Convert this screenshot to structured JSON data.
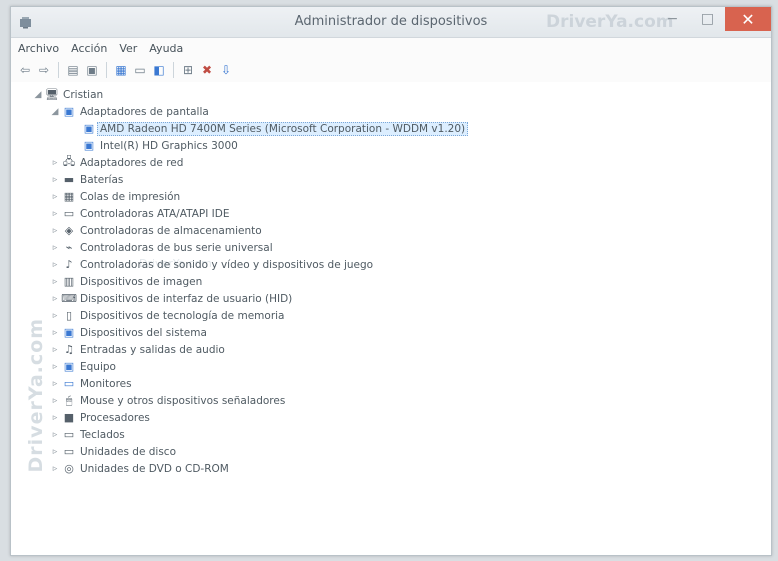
{
  "window": {
    "title": "Administrador de dispositivos",
    "watermark_title": "DriverYa.com",
    "side_watermark": "DriverYa.com",
    "row_watermark": "DriverYa.com"
  },
  "menu": {
    "items": [
      "Archivo",
      "Acción",
      "Ver",
      "Ayuda"
    ]
  },
  "toolbar": {
    "icons": [
      "back-icon",
      "forward-icon",
      "properties-icon",
      "help-icon",
      "device-manager-icon",
      "monitor-icon",
      "scan-icon",
      "update-driver-icon",
      "uninstall-icon",
      "disable-icon"
    ]
  },
  "tree": {
    "root": "Cristian",
    "expanded_category": "Adaptadores de pantalla",
    "display_children": [
      "AMD Radeon HD 7400M Series (Microsoft Corporation - WDDM v1.20)",
      "Intel(R) HD Graphics 3000"
    ],
    "categories": [
      "Adaptadores de red",
      "Baterías",
      "Colas de impresión",
      "Controladoras ATA/ATAPI IDE",
      "Controladoras de almacenamiento",
      "Controladoras de bus serie universal",
      "Controladoras de sonido y vídeo y dispositivos de juego",
      "Dispositivos de imagen",
      "Dispositivos de interfaz de usuario (HID)",
      "Dispositivos de tecnología de memoria",
      "Dispositivos del sistema",
      "Entradas y salidas de audio",
      "Equipo",
      "Monitores",
      "Mouse y otros dispositivos señaladores",
      "Procesadores",
      "Teclados",
      "Unidades de disco",
      "Unidades de DVD o CD-ROM"
    ]
  },
  "colors": {
    "titlebar": "#e8ecef",
    "close_button": "#d8634f",
    "selection": "#dceeff"
  }
}
